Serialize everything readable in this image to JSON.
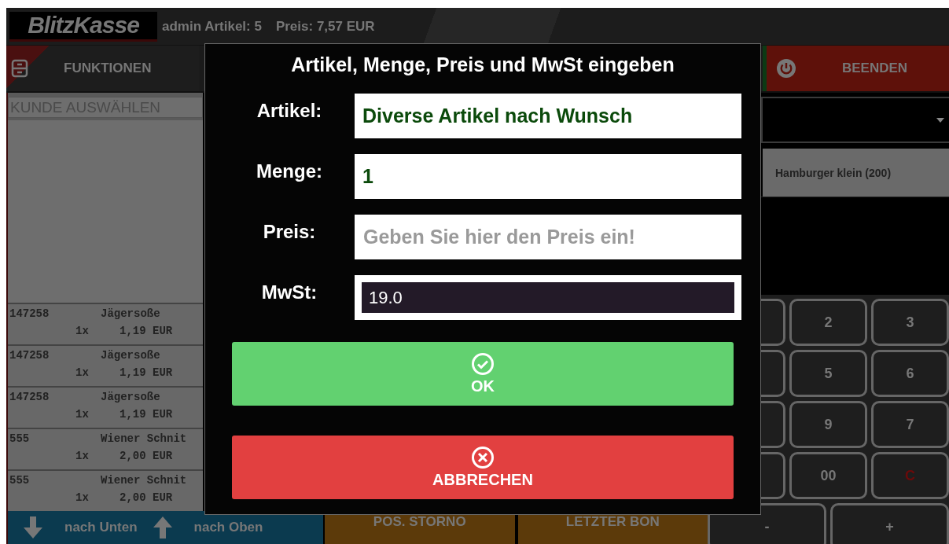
{
  "header": {
    "logo": "BlitzKasse",
    "user_info": "admin Artikel: 5",
    "total": "Preis: 7,57 EUR"
  },
  "toolbar": [
    {
      "label": "FUNKTIONEN",
      "kind": "functions"
    },
    {
      "label": "BEENDEN",
      "kind": "quit"
    }
  ],
  "customer_field": {
    "placeholder": "KUNDE AUSWÄHLEN"
  },
  "order_items": [
    {
      "code": "147258",
      "name": "Jägersoße",
      "quantity": "1x",
      "price": "1,19 EUR"
    },
    {
      "code": "147258",
      "name": "Jägersoße",
      "quantity": "1x",
      "price": "1,19 EUR"
    },
    {
      "code": "147258",
      "name": "Jägersoße",
      "quantity": "1x",
      "price": "1,19 EUR"
    },
    {
      "code": "555",
      "name": "Wiener Schnit",
      "quantity": "1x",
      "price": "2,00 EUR"
    },
    {
      "code": "555",
      "name": "Wiener Schnit",
      "quantity": "1x",
      "price": "2,00 EUR"
    }
  ],
  "nav_buttons": [
    {
      "label": "nach Unten",
      "kind": "down"
    },
    {
      "label": "nach Oben",
      "kind": "up"
    }
  ],
  "action_buttons": [
    "POS. STORNO",
    "LETZTER BON"
  ],
  "product_tiles": [
    "Hamburger klein (200)"
  ],
  "keypad": {
    "rows": [
      [
        "2",
        "3"
      ],
      [
        "5",
        "6"
      ],
      [
        "9",
        "7"
      ],
      [
        "00",
        {
          "label": "C",
          "kind": "clear"
        }
      ],
      [
        "-",
        "+"
      ]
    ]
  },
  "dialog": {
    "title": "Artikel, Menge, Preis und MwSt eingeben",
    "fields": [
      {
        "label": "Artikel:",
        "value": "Diverse Artikel nach Wunsch",
        "kind": "text"
      },
      {
        "label": "Menge:",
        "value": "1",
        "kind": "text"
      },
      {
        "label": "Preis:",
        "placeholder": "Geben Sie hier den Preis ein!",
        "kind": "text"
      },
      {
        "label": "MwSt:",
        "value": "19.0",
        "kind": "select"
      }
    ],
    "buttons": [
      {
        "label": "OK",
        "kind": "confirm"
      },
      {
        "label": "ABBRECHEN",
        "kind": "cancel"
      }
    ]
  }
}
